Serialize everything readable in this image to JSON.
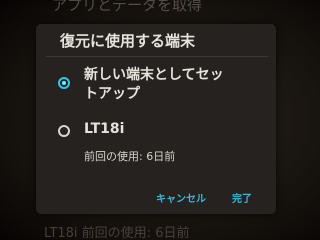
{
  "background": {
    "title": "アプリとデータを取得",
    "bottom_text": "LT18i 前回の使用: 6日前"
  },
  "dialog": {
    "title": "復元に使用する端末",
    "options": [
      {
        "label_line1": "新しい端末としてセッ",
        "label_line2": "トアップ",
        "selected": true
      },
      {
        "label": "LT18i",
        "subtitle": "前回の使用: 6日前",
        "selected": false
      }
    ],
    "buttons": {
      "cancel": "キャンセル",
      "done": "完了"
    }
  },
  "colors": {
    "accent": "#2fc7e6",
    "button_text": "#3ab8d8",
    "dialog_bg": "#26221f"
  }
}
